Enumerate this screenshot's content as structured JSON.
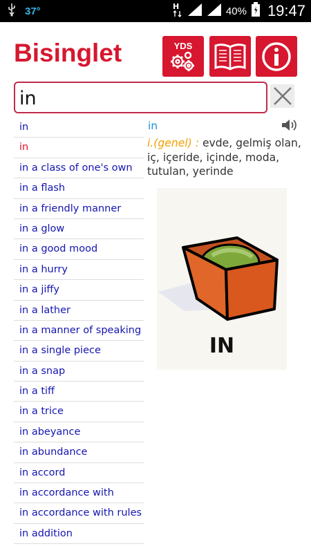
{
  "status_bar": {
    "temperature": "37°",
    "battery_percent": "40%",
    "time": "19:47"
  },
  "header": {
    "title": "Bisinglet",
    "yds_label": "YDS",
    "buttons": [
      "yds-button",
      "book-button",
      "info-button"
    ]
  },
  "search": {
    "query": "in"
  },
  "word_list": [
    {
      "text": "in",
      "active": false
    },
    {
      "text": "in",
      "active": true
    },
    {
      "text": "in a class of one's own",
      "active": false
    },
    {
      "text": "in a flash",
      "active": false
    },
    {
      "text": "in a friendly manner",
      "active": false
    },
    {
      "text": "in a glow",
      "active": false
    },
    {
      "text": "in a good mood",
      "active": false
    },
    {
      "text": "in a hurry",
      "active": false
    },
    {
      "text": "in a jiffy",
      "active": false
    },
    {
      "text": "in a lather",
      "active": false
    },
    {
      "text": "in a manner of speaking",
      "active": false
    },
    {
      "text": "in a single piece",
      "active": false
    },
    {
      "text": "in a snap",
      "active": false
    },
    {
      "text": "in a tiff",
      "active": false
    },
    {
      "text": "in a trice",
      "active": false
    },
    {
      "text": "in abeyance",
      "active": false
    },
    {
      "text": "in abundance",
      "active": false
    },
    {
      "text": "in accord",
      "active": false
    },
    {
      "text": "in accordance with",
      "active": false
    },
    {
      "text": "in accordance with rules",
      "active": false
    },
    {
      "text": "in addition",
      "active": false
    }
  ],
  "detail": {
    "word": "in",
    "part_of_speech": "i.(genel) :",
    "meaning": " evde, gelmiş olan, iç, içeride, içinde, moda, tutulan, yerinde",
    "illustration_caption": "IN"
  },
  "colors": {
    "brand_red": "#d6172f",
    "link_blue": "#1515b0",
    "detail_blue": "#1b8fd8",
    "pos_orange": "#f0a000",
    "temp_cyan": "#33b5e5"
  }
}
